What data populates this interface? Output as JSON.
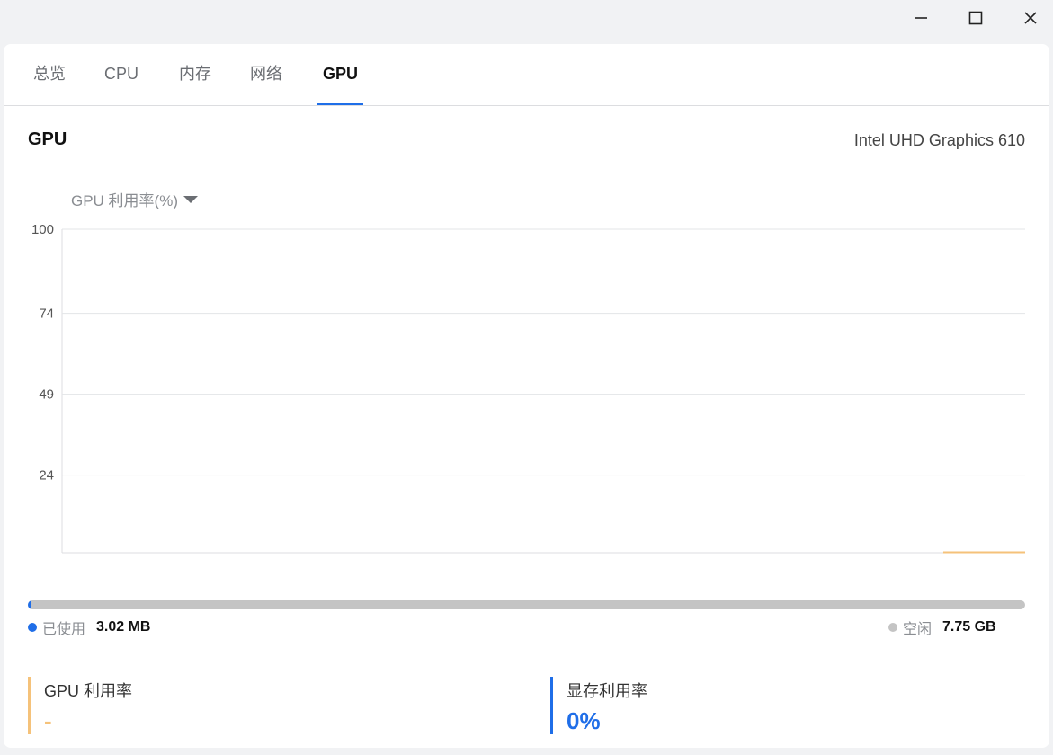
{
  "window_controls": {
    "minimize_icon": "minimize-icon",
    "maximize_icon": "maximize-icon",
    "close_icon": "close-icon"
  },
  "tabs": [
    {
      "label": "总览",
      "active": false
    },
    {
      "label": "CPU",
      "active": false
    },
    {
      "label": "内存",
      "active": false
    },
    {
      "label": "网络",
      "active": false
    },
    {
      "label": "GPU",
      "active": true
    }
  ],
  "section": {
    "title": "GPU",
    "device_name": "Intel UHD Graphics 610"
  },
  "metric_selector": {
    "label": "GPU 利用率(%)",
    "icon": "caret-down-icon"
  },
  "chart_data": {
    "type": "line",
    "y_ticks": [
      "100",
      "74",
      "49",
      "24"
    ],
    "ylim": [
      0,
      100
    ],
    "series": [
      {
        "values": [
          0,
          0
        ],
        "color": "#f5c27a",
        "x_range_fraction": [
          0.915,
          1.0
        ]
      }
    ],
    "grid": true
  },
  "memory": {
    "used_fraction": 0.0004,
    "used_label": "已使用",
    "used_value": "3.02 MB",
    "free_label": "空闲",
    "free_value": "7.75 GB",
    "used_color": "#1f6ee8",
    "free_color": "#c4c4c4"
  },
  "stats": {
    "gpu_util": {
      "label": "GPU 利用率",
      "value": "-",
      "color": "#f5c27a"
    },
    "vram_util": {
      "label": "显存利用率",
      "value": "0%",
      "color": "#1f6ee8"
    }
  }
}
